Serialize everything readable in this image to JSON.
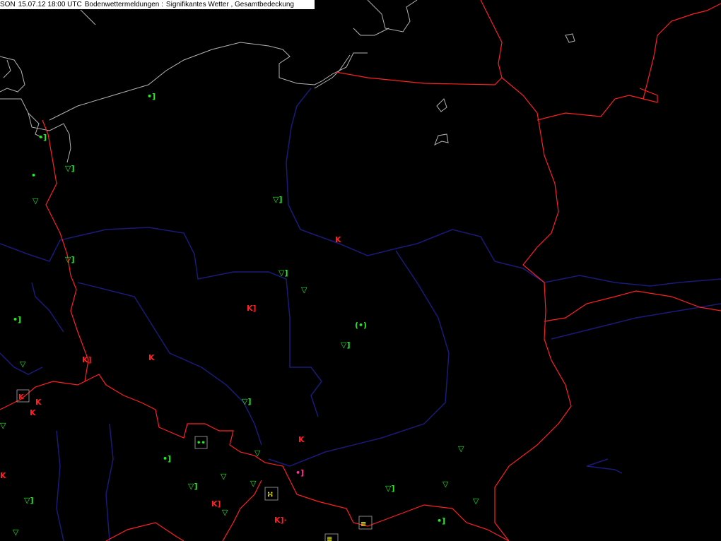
{
  "header": {
    "product": "SON",
    "datetime": "15.07.12 18:00 UTC",
    "title": "Bodenwettermeldungen :",
    "layers": "Signifikantes Wetter , Gesamtbedeckung"
  },
  "colors": {
    "background": "#000000",
    "coastline": "#b4b4b4",
    "border": "#ff2020",
    "river": "#1a1a7a",
    "rain": "#22ee22",
    "thunder": "#ff2020",
    "fog": "#ffff00",
    "drizzle": "#ff3399"
  },
  "stations": [
    {
      "type": "rain-shower",
      "label": "▽]"
    },
    {
      "type": "thunderstorm",
      "label": "K"
    },
    {
      "type": "rain-intermittent",
      "label": "•]"
    },
    {
      "type": "fog",
      "label": "≡"
    }
  ]
}
